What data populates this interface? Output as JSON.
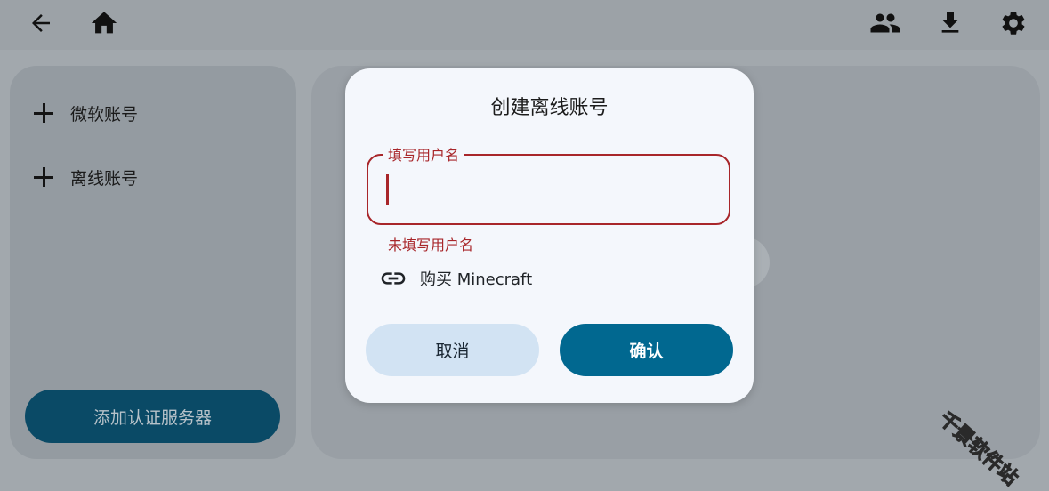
{
  "toolbar": {
    "back_icon": "arrow-left-icon",
    "home_icon": "home-icon",
    "accounts_icon": "people-icon",
    "download_icon": "download-icon",
    "settings_icon": "gear-icon"
  },
  "sidebar": {
    "items": [
      {
        "label": "微软账号",
        "icon": "plus-icon"
      },
      {
        "label": "离线账号",
        "icon": "plus-icon"
      }
    ],
    "auth_server_button": "添加认证服务器"
  },
  "dialog": {
    "title": "创建离线账号",
    "field_label": "填写用户名",
    "field_value": "",
    "error_text": "未填写用户名",
    "buy_link": {
      "label": "购买 Minecraft",
      "icon": "link-icon"
    },
    "cancel_label": "取消",
    "confirm_label": "确认"
  },
  "watermark": "千景软件站",
  "colors": {
    "primary": "#016890",
    "error": "#a8262a",
    "cancel_bg": "#d2e3f3",
    "dialog_bg": "#f4f7fc",
    "auth_button_bg": "#0a4a66"
  }
}
